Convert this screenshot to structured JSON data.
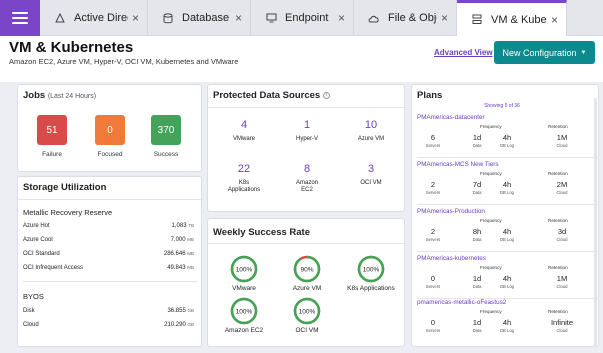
{
  "tabs": [
    {
      "label": "Active Directory",
      "icon": "triangle-icon",
      "active": false
    },
    {
      "label": "Database",
      "icon": "database-icon",
      "active": false
    },
    {
      "label": "Endpoint",
      "icon": "monitor-icon",
      "active": false
    },
    {
      "label": "File & Object",
      "icon": "cloud-icon",
      "active": false
    },
    {
      "label": "VM & Kubernetes",
      "icon": "stack-icon",
      "active": true
    }
  ],
  "header": {
    "title": "VM & Kubernetes",
    "subtitle": "Amazon EC2, Azure VM, Hyper-V, OCI VM, Kubernetes and VMware",
    "advanced_view": "Advanced View",
    "new_config": "New Configuration"
  },
  "jobs": {
    "title": "Jobs",
    "period": "(Last 24 Hours)",
    "items": [
      {
        "value": "51",
        "label": "Failure",
        "color": "#d94a4a"
      },
      {
        "value": "0",
        "label": "Focused",
        "color": "#ef7a3a"
      },
      {
        "value": "370",
        "label": "Success",
        "color": "#44a35a"
      }
    ]
  },
  "storage": {
    "title": "Storage Utilization",
    "sections": [
      {
        "name": "Metallic Recovery Reserve",
        "rows": [
          {
            "label": "Azure Hot",
            "value": "1,083",
            "unit": "TB"
          },
          {
            "label": "Azure Cool",
            "value": "7.000",
            "unit": "MB"
          },
          {
            "label": "OCI Standard",
            "value": "286.646",
            "unit": "MB"
          },
          {
            "label": "OCI Infrequent Access",
            "value": "49.843",
            "unit": "MB"
          }
        ]
      },
      {
        "name": "BYOS",
        "rows": [
          {
            "label": "Disk",
            "value": "36.855",
            "unit": "GB"
          },
          {
            "label": "Cloud",
            "value": "210.290",
            "unit": "GB"
          }
        ]
      }
    ]
  },
  "protected": {
    "title": "Protected Data Sources",
    "items": [
      {
        "value": "4",
        "label": "VMware"
      },
      {
        "value": "1",
        "label": "Hyper-V"
      },
      {
        "value": "10",
        "label": "Azure VM"
      },
      {
        "value": "22",
        "label": "K8s Applications"
      },
      {
        "value": "8",
        "label": "Amazon EC2"
      },
      {
        "value": "3",
        "label": "OCI VM"
      }
    ]
  },
  "weekly": {
    "title": "Weekly Success Rate",
    "items": [
      {
        "percent": 100,
        "text": "100%",
        "label": "VMware"
      },
      {
        "percent": 90,
        "text": "90%",
        "label": "Azure VM"
      },
      {
        "percent": 100,
        "text": "100%",
        "label": "K8s Applications"
      },
      {
        "percent": 100,
        "text": "100%",
        "label": "Amazon EC2"
      },
      {
        "percent": 100,
        "text": "100%",
        "label": "OCI VM"
      }
    ]
  },
  "plans": {
    "title": "Plans",
    "showing": "Showing 5 of 36",
    "headers": {
      "frequency": "Frequency",
      "retention": "Retention"
    },
    "sublabels": {
      "servers": "Servers",
      "data": "Data",
      "db_log": "DB Log",
      "cloud": "Cloud"
    },
    "items": [
      {
        "name": "PMAmericas-datacenter",
        "servers": "6",
        "data": "1d",
        "db_log": "4h",
        "cloud": "1M"
      },
      {
        "name": "PMAmericas-MCS New Tiers",
        "servers": "2",
        "data": "7d",
        "db_log": "4h",
        "cloud": "2M"
      },
      {
        "name": "PMAmericas-Production",
        "servers": "2",
        "data": "8h",
        "db_log": "4h",
        "cloud": "3d"
      },
      {
        "name": "PMAmericas-kubernetes",
        "servers": "0",
        "data": "1d",
        "db_log": "4h",
        "cloud": "1M"
      },
      {
        "name": "pmamericas-metallic-oFeastus2",
        "servers": "0",
        "data": "1d",
        "db_log": "4h",
        "cloud": "Infinite"
      }
    ]
  },
  "colors": {
    "accent": "#7a45c6",
    "teal": "#0d8a8e",
    "ring": "#3fa653",
    "ring_gap": "#d94a4a"
  }
}
